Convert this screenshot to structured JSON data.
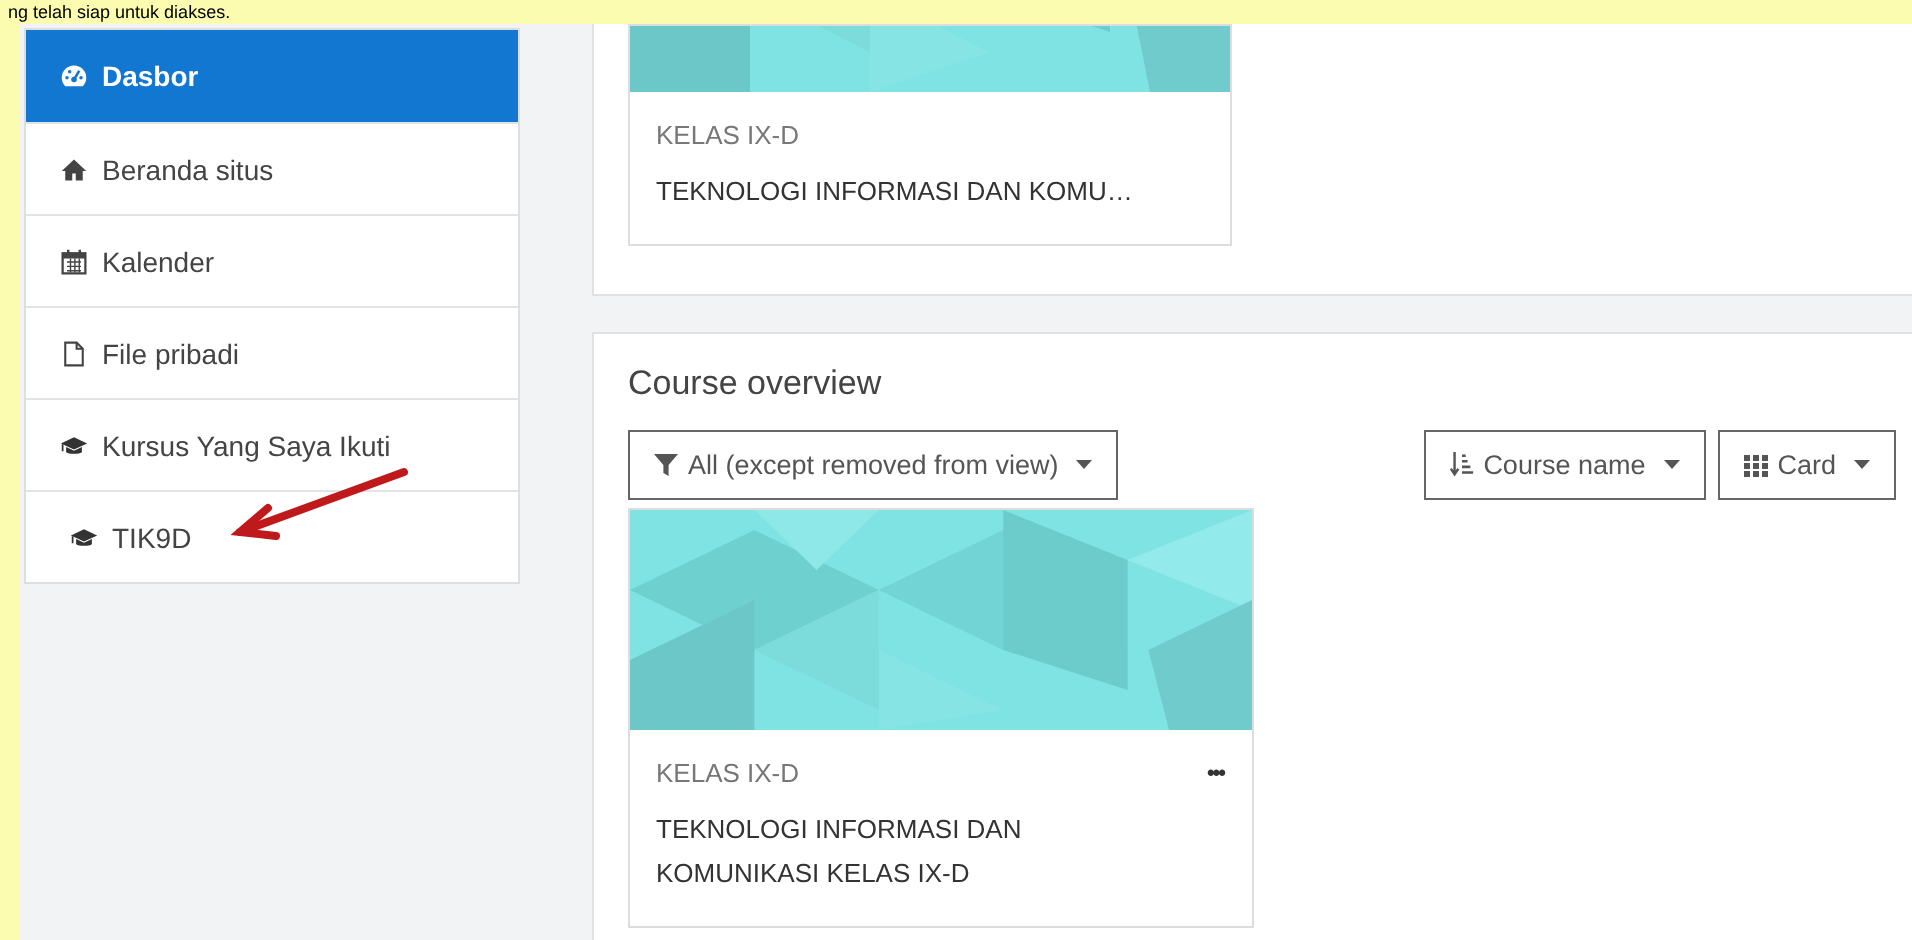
{
  "caption": "ng telah siap untuk diakses.",
  "sidebar": {
    "items": [
      {
        "label": "Dasbor",
        "selected": true
      },
      {
        "label": "Beranda situs",
        "selected": false
      },
      {
        "label": "Kalender",
        "selected": false
      },
      {
        "label": "File pribadi",
        "selected": false
      },
      {
        "label": "Kursus Yang Saya Ikuti",
        "selected": false,
        "children": [
          {
            "label": "TIK9D",
            "selected": false
          }
        ]
      }
    ]
  },
  "top_course": {
    "category": "KELAS IX-D",
    "title": "TEKNOLOGI INFORMASI DAN KOMU…"
  },
  "course_overview": {
    "title": "Course overview",
    "filter": "All (except removed from view)",
    "sort": "Course name",
    "view": "Card",
    "courses": [
      {
        "category": "KELAS IX-D",
        "title": "TEKNOLOGI INFORMASI DAN KOMUNIKASI KELAS IX-D",
        "menu": "•••"
      }
    ]
  }
}
